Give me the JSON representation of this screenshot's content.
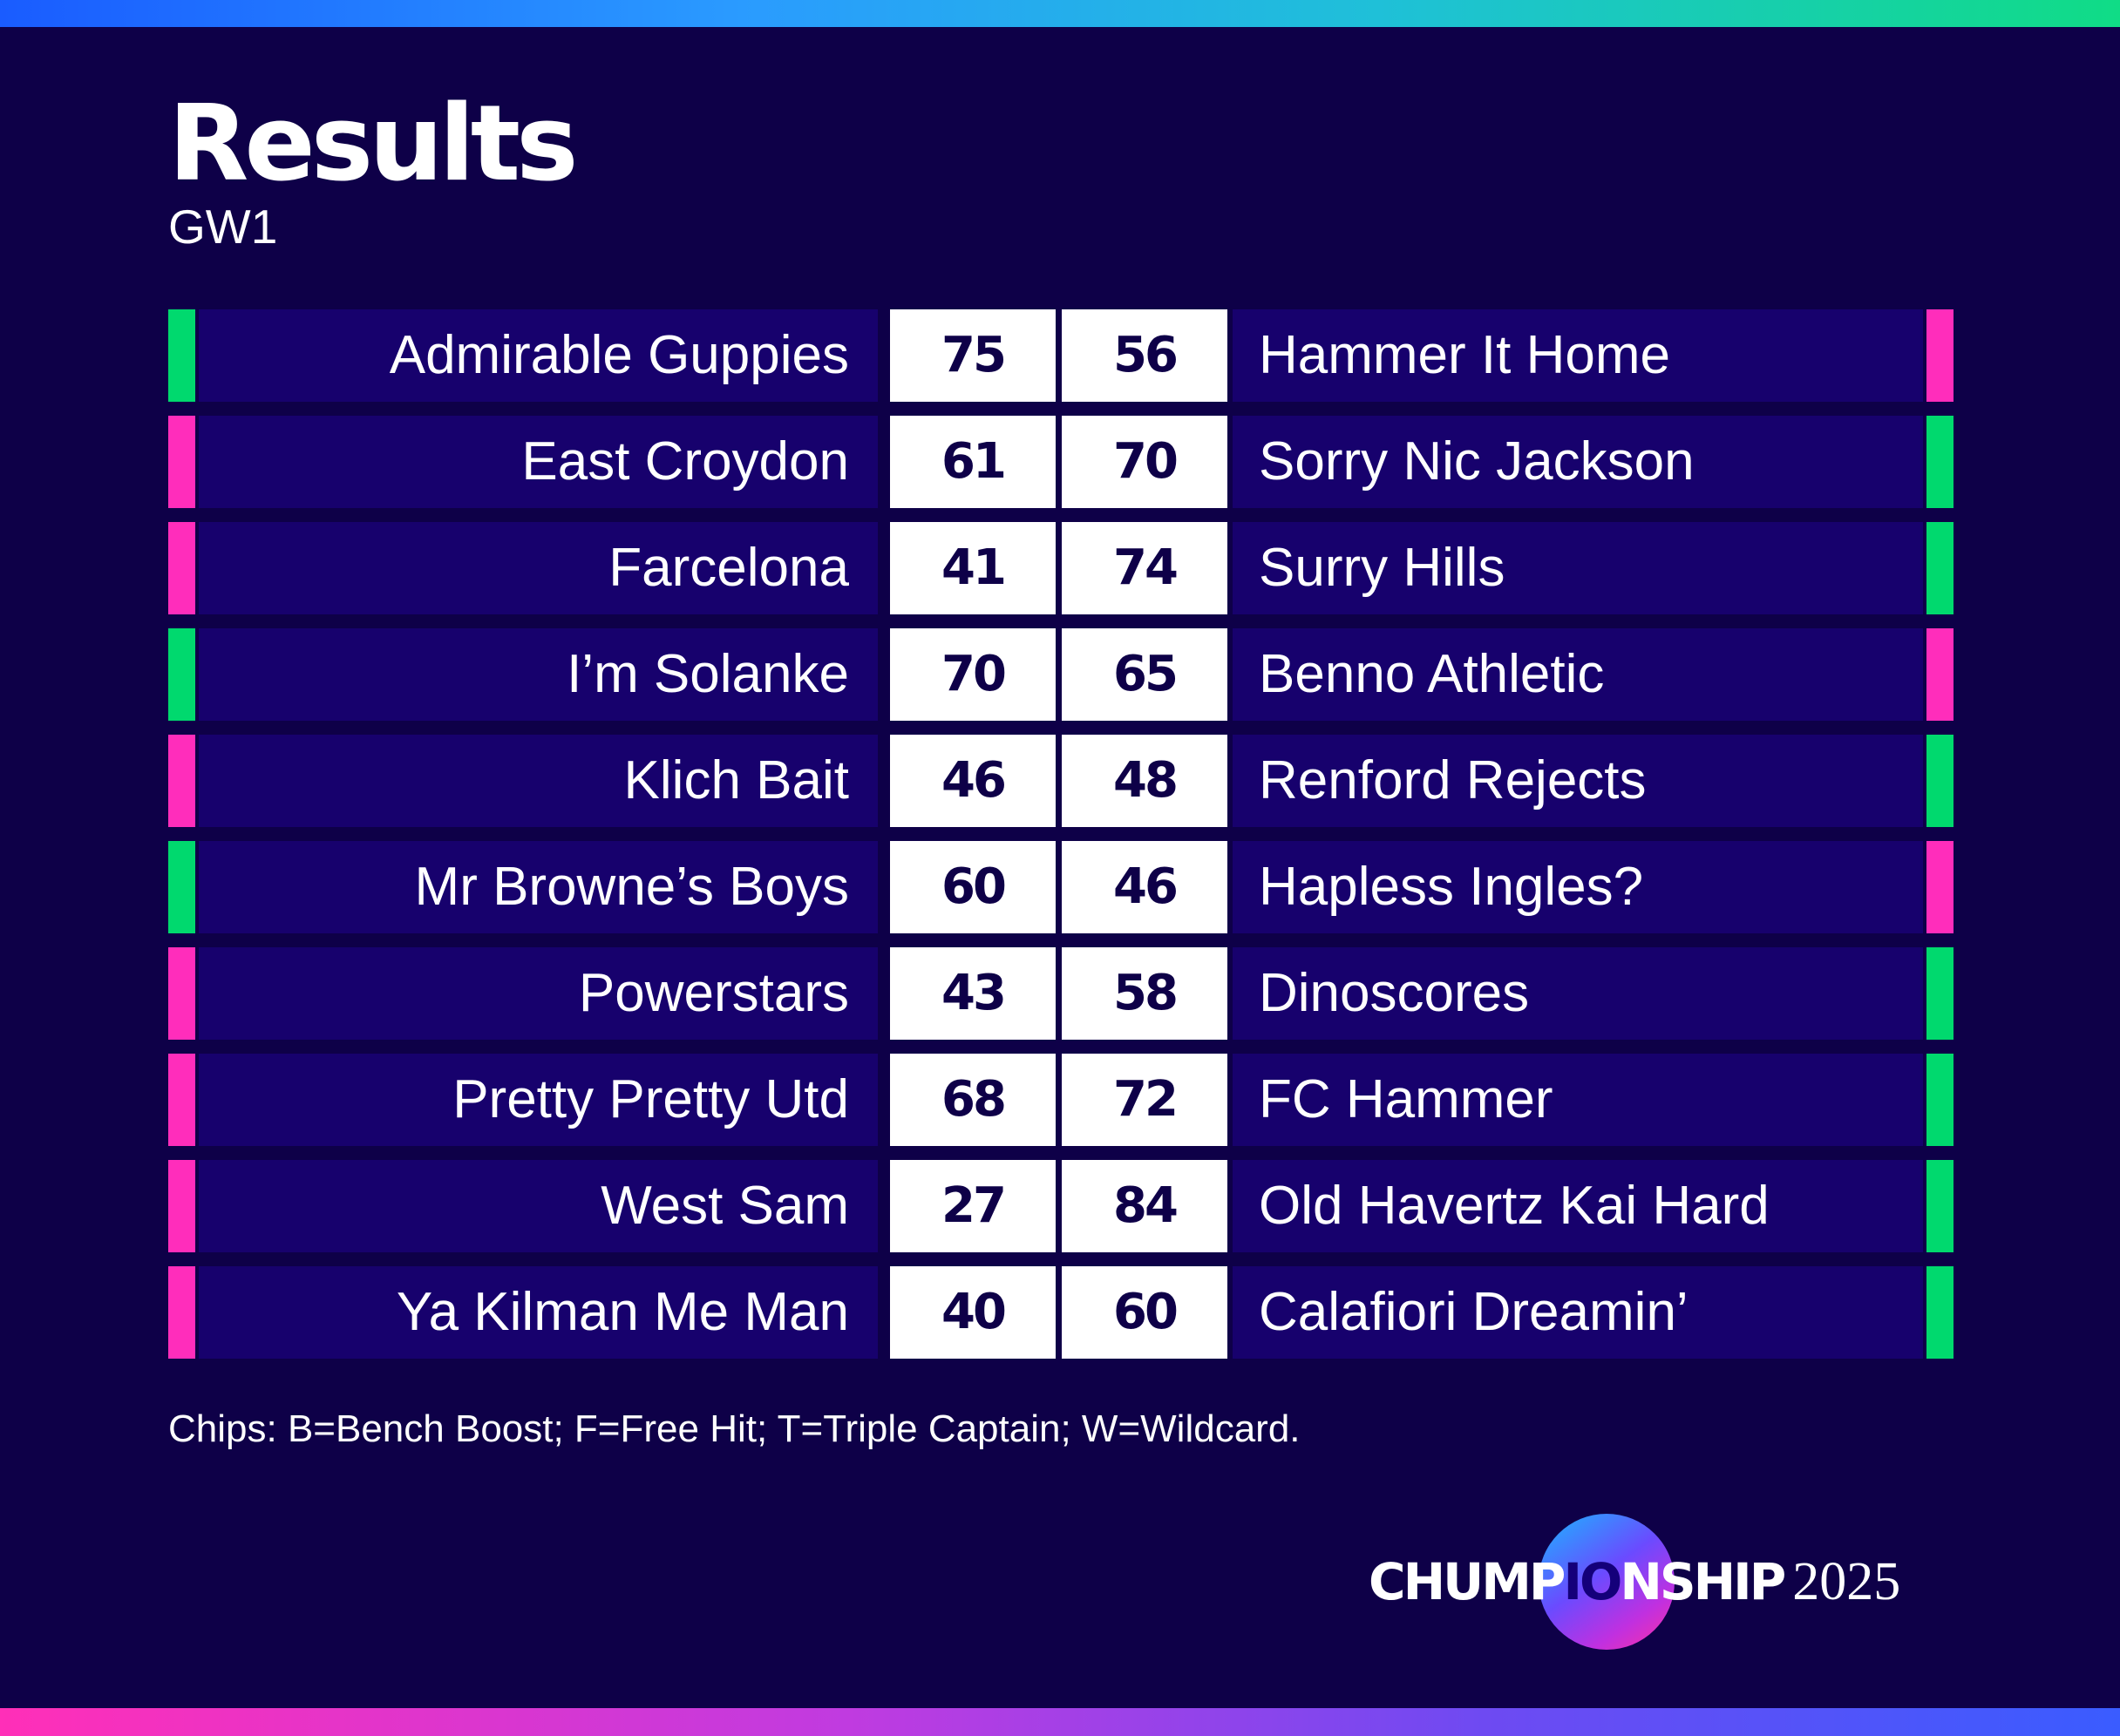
{
  "header": {
    "title": "Results",
    "subtitle": "GW1"
  },
  "colors": {
    "background": "#0e0048",
    "row_fill": "#17016d",
    "score_fill": "#ffffff",
    "win_marker": "#00d96e",
    "loss_marker": "#ff2dbb"
  },
  "results": [
    {
      "home": "Admirable Guppies",
      "home_score": "75",
      "away_score": "56",
      "away": "Hammer It Home",
      "home_result": "win",
      "away_result": "loss"
    },
    {
      "home": "East Croydon",
      "home_score": "61",
      "away_score": "70",
      "away": "Sorry Nic Jackson",
      "home_result": "loss",
      "away_result": "win"
    },
    {
      "home": "Farcelona",
      "home_score": "41",
      "away_score": "74",
      "away": "Surry Hills",
      "home_result": "loss",
      "away_result": "win"
    },
    {
      "home": "I’m Solanke",
      "home_score": "70",
      "away_score": "65",
      "away": "Benno Athletic",
      "home_result": "win",
      "away_result": "loss"
    },
    {
      "home": "Klich Bait",
      "home_score": "46",
      "away_score": "48",
      "away": "Renford Rejects",
      "home_result": "loss",
      "away_result": "win"
    },
    {
      "home": "Mr Browne’s Boys",
      "home_score": "60",
      "away_score": "46",
      "away": "Hapless Ingles?",
      "home_result": "win",
      "away_result": "loss"
    },
    {
      "home": "Powerstars",
      "home_score": "43",
      "away_score": "58",
      "away": "Dinoscores",
      "home_result": "loss",
      "away_result": "win"
    },
    {
      "home": "Pretty Pretty Utd",
      "home_score": "68",
      "away_score": "72",
      "away": "FC Hammer",
      "home_result": "loss",
      "away_result": "win"
    },
    {
      "home": "West Sam",
      "home_score": "27",
      "away_score": "84",
      "away": "Old Havertz Kai Hard",
      "home_result": "loss",
      "away_result": "win"
    },
    {
      "home": "Ya Kilman Me Man",
      "home_score": "40",
      "away_score": "60",
      "away": "Calafiori Dreamin’",
      "home_result": "loss",
      "away_result": "win"
    }
  ],
  "footer": {
    "chips_note": "Chips: B=Bench Boost; F=Free Hit; T=Triple Captain; W=Wildcard.",
    "brand": {
      "part1": "CHUMP",
      "part2": "IO",
      "part3": "NSHIP",
      "year": "2025"
    }
  }
}
